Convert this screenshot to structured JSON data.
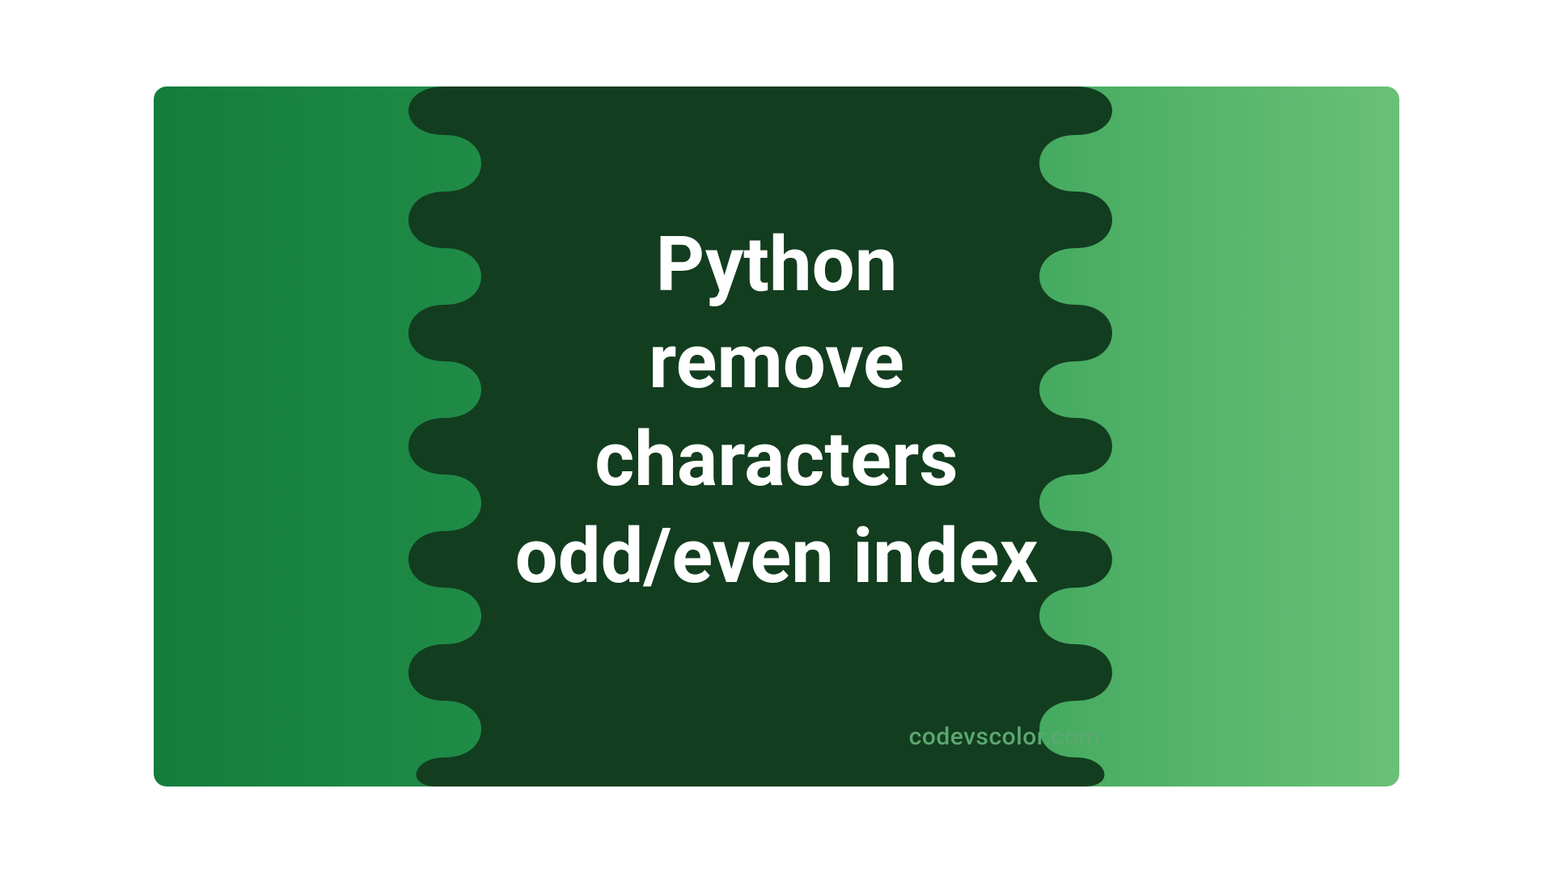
{
  "title": "Python\nremove\ncharacters\nodd/even index",
  "watermark": "codevscolor.com",
  "colors": {
    "blob": "#133d1f",
    "text": "#ffffff",
    "watermark": "#5aa870"
  }
}
